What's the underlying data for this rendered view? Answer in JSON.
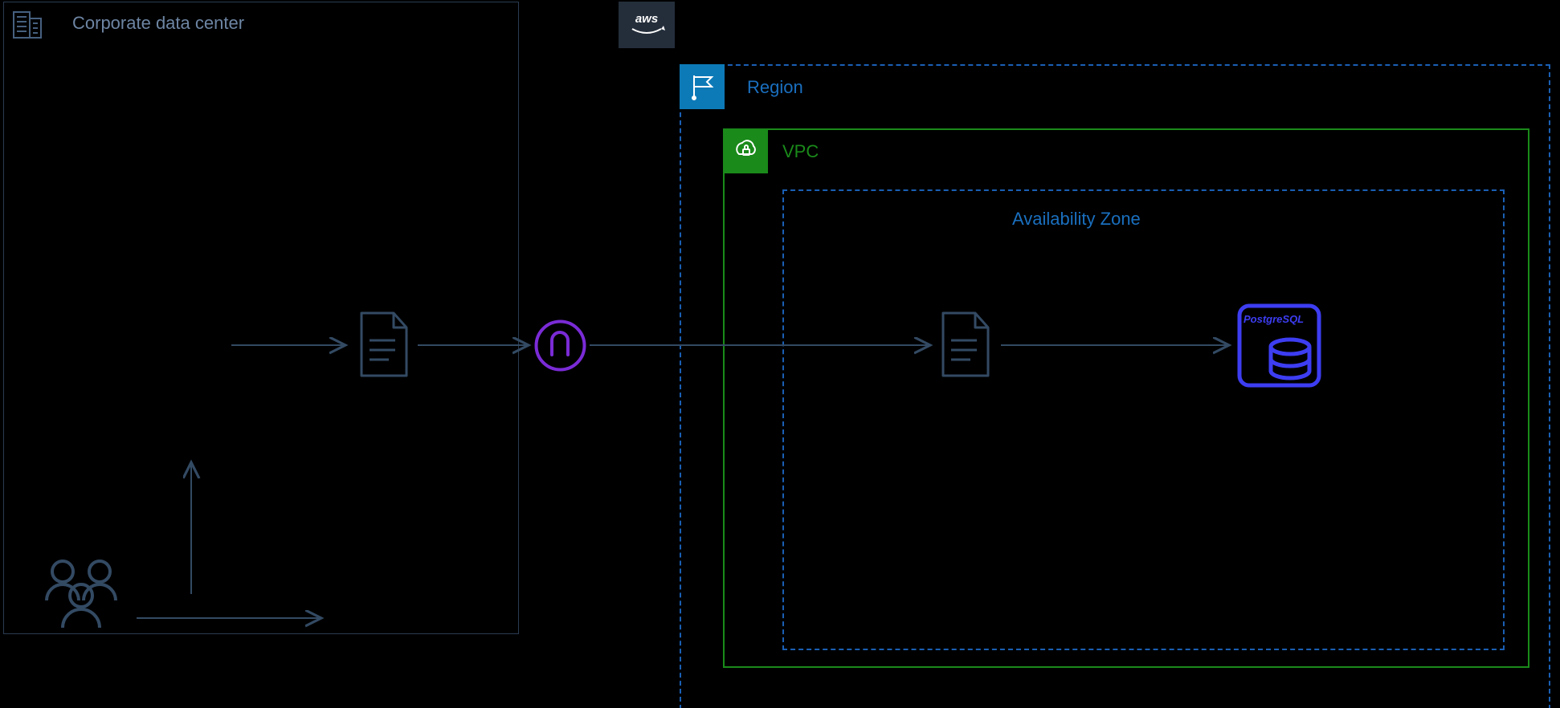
{
  "corporate": {
    "label": "Corporate data center"
  },
  "aws": {
    "label": "aws"
  },
  "region": {
    "label": "Region"
  },
  "vpc": {
    "label": "VPC"
  },
  "az": {
    "label": "Availability Zone"
  },
  "postgres": {
    "label": "PostgreSQL"
  },
  "colors": {
    "outline_gray": "#2a3b52",
    "region_blue": "#1a6fbf",
    "vpc_green": "#1a8a1a",
    "purple": "#7a2bd6",
    "pg_blue": "#3d3df2"
  }
}
